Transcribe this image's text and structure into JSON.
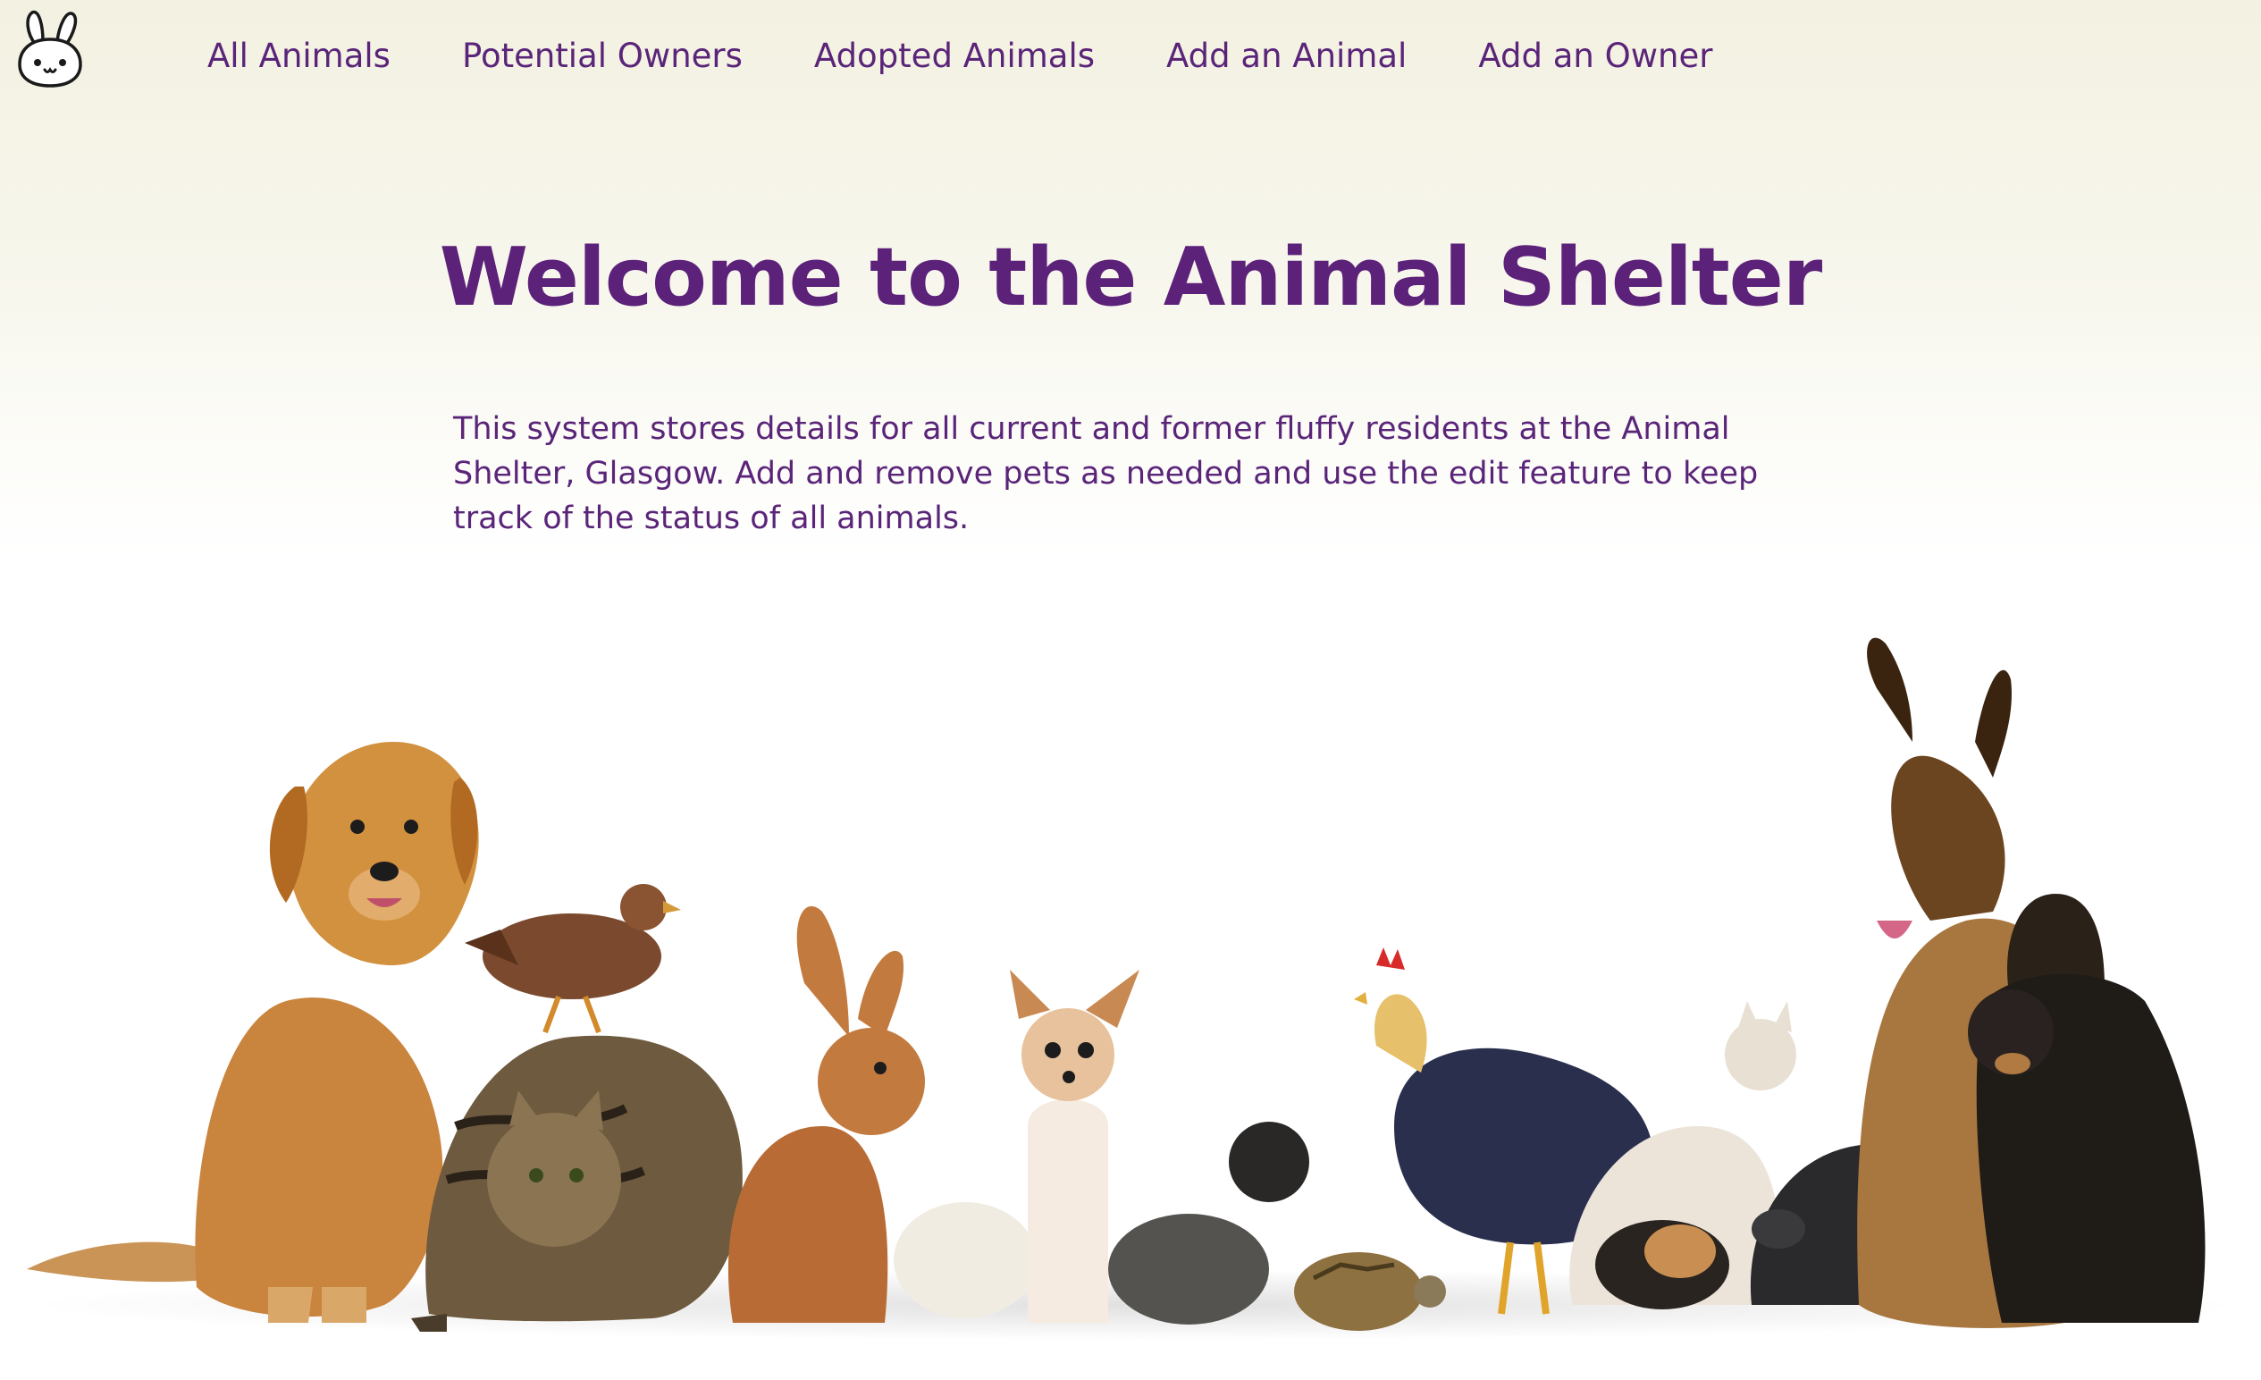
{
  "app": {
    "logo_icon": "bunny-face-icon"
  },
  "nav": {
    "items": [
      {
        "label": "All Animals"
      },
      {
        "label": "Potential Owners"
      },
      {
        "label": "Adopted Animals"
      },
      {
        "label": "Add an Animal"
      },
      {
        "label": "Add an Owner"
      }
    ]
  },
  "main": {
    "title": "Welcome to the Animal Shelter",
    "intro": "This system stores details for all current and former fluffy residents at the Animal Shelter, Glasgow. Add and remove pets as needed and use the edit feature to keep track of the status of all animals."
  },
  "hero_image": {
    "subject": "group-of-animals-icon"
  },
  "colors": {
    "accent": "#5c2179",
    "nav_text": "#5a2579",
    "header_bg": "#f3f1e1",
    "page_bg": "#ffffff"
  }
}
